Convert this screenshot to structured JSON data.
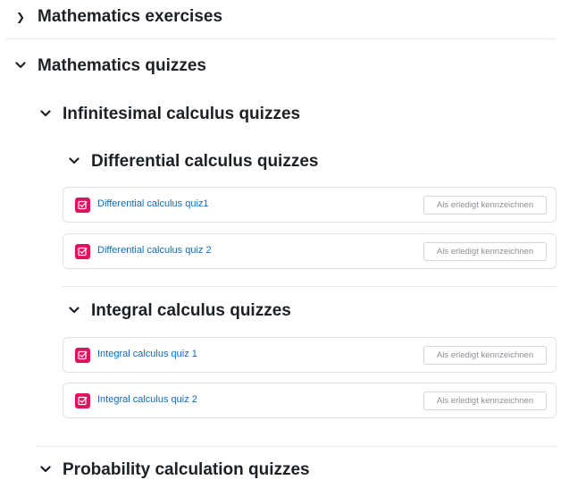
{
  "sections": {
    "exercises": {
      "title": "Mathematics exercises",
      "chevron": ">"
    },
    "quizzes": {
      "title": "Mathematics quizzes",
      "chevron": "⌄"
    },
    "infinitesimal": {
      "title": "Infinitesimal calculus quizzes",
      "chevron": "⌄"
    },
    "differential": {
      "title": "Differential calculus quizzes",
      "chevron": "⌄"
    },
    "integral": {
      "title": "Integral calculus quizzes",
      "chevron": "⌄"
    },
    "probability": {
      "title": "Probability calculation quizzes",
      "chevron": "⌄"
    }
  },
  "activities": {
    "diff_quiz_1": {
      "label": "Differential calculus quiz1",
      "icon": "quiz-icon",
      "completion": "Als erledigt kennzeichnen"
    },
    "diff_quiz_2": {
      "label": "Differential calculus quiz 2",
      "icon": "quiz-icon",
      "completion": "Als erledigt kennzeichnen"
    },
    "int_quiz_1": {
      "label": "Integral calculus quiz 1",
      "icon": "quiz-icon",
      "completion": "Als erledigt kennzeichnen"
    },
    "int_quiz_2": {
      "label": "Integral calculus quiz 2",
      "icon": "quiz-icon",
      "completion": "Als erledigt kennzeichnen"
    }
  },
  "colors": {
    "quiz_icon": "#e2135e",
    "link": "#0f6cbf"
  }
}
